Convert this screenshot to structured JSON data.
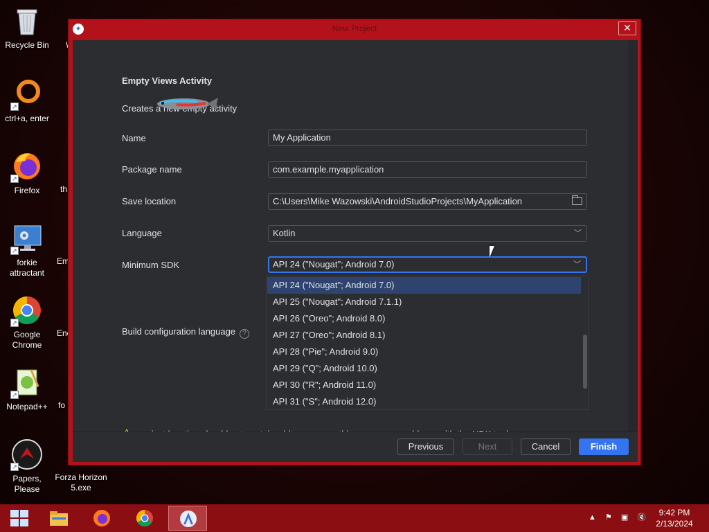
{
  "desktop": {
    "icons": [
      {
        "label": "Recycle Bin",
        "icon": "recycle-bin-icon"
      },
      {
        "label": "ctrl+a, enter",
        "icon": "ring-icon"
      },
      {
        "label": "Firefox",
        "icon": "firefox-icon"
      },
      {
        "label": "forkie attractant",
        "icon": "monitor-gear-icon"
      },
      {
        "label": "Google Chrome",
        "icon": "chrome-icon"
      },
      {
        "label": "Notepad++",
        "icon": "notepad-plus-plus-icon"
      },
      {
        "label": "Papers, Please",
        "icon": "papers-please-icon"
      },
      {
        "label": "Forza Horizon 5.exe",
        "icon": "forza-icon"
      }
    ],
    "peeks": [
      "W",
      "th",
      "Em D",
      "Enc",
      "fo so"
    ]
  },
  "dialog": {
    "title": "New Project",
    "heading": "Empty Views Activity",
    "description": "Creates a new empty activity",
    "fields": {
      "name_label": "Name",
      "name_value": "My Application",
      "package_label": "Package name",
      "package_value": "com.example.myapplication",
      "save_label": "Save location",
      "save_value": "C:\\Users\\Mike Wazowski\\AndroidStudioProjects\\MyApplication",
      "language_label": "Language",
      "language_value": "Kotlin",
      "min_sdk_label": "Minimum SDK",
      "min_sdk_value": "API 24 (\"Nougat\"; Android 7.0)",
      "build_config_label": "Build configuration language"
    },
    "sdk_options": [
      "API 24 (\"Nougat\"; Android 7.0)",
      "API 25 (\"Nougat\"; Android 7.1.1)",
      "API 26 (\"Oreo\"; Android 8.0)",
      "API 27 (\"Oreo\"; Android 8.1)",
      "API 28 (\"Pie\"; Android 9.0)",
      "API 29 (\"Q\"; Android 10.0)",
      "API 30 (\"R\"; Android 11.0)",
      "API 31 (\"S\"; Android 12.0)"
    ],
    "selected_sdk_index": 0,
    "warning": "project location should not contain whitespace, as this can cause problems with the NDK tools.",
    "buttons": {
      "previous": "Previous",
      "next": "Next",
      "cancel": "Cancel",
      "finish": "Finish"
    },
    "accent_color": "#3574f0"
  },
  "taskbar": {
    "apps": [
      "start-icon",
      "file-explorer-icon",
      "firefox-icon",
      "chrome-icon",
      "android-studio-icon"
    ],
    "active_app": "android-studio-icon",
    "time": "9:42 PM",
    "date": "2/13/2024"
  }
}
